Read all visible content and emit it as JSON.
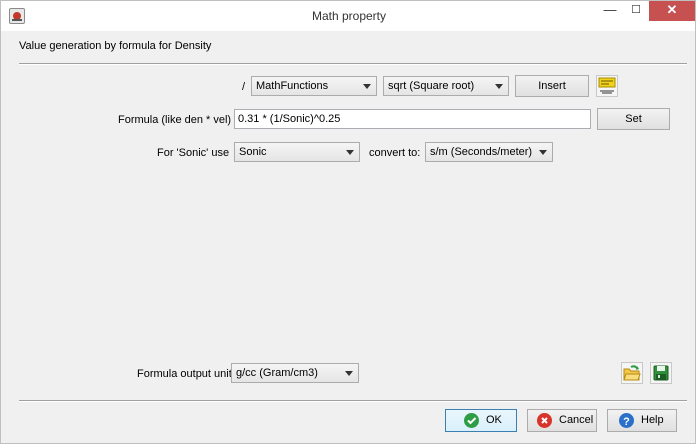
{
  "window": {
    "title": "Math property",
    "minimize_glyph": "—",
    "maximize_glyph": "☐",
    "close_glyph": "✕"
  },
  "heading": "Value generation by formula for Density",
  "functions_row": {
    "divider_label": "/",
    "category_value": "MathFunctions",
    "function_value": "sqrt (Square root)",
    "insert_label": "Insert",
    "formula_icon": "formula-editor-icon"
  },
  "formula": {
    "label": "Formula (like den * vel)",
    "value": "0.31 * (1/Sonic)^0.25",
    "set_label": "Set"
  },
  "variable_row": {
    "label": "For 'Sonic' use",
    "source_value": "Sonic",
    "convert_label": "convert to:",
    "unit_value": "s/m (Seconds/meter)"
  },
  "output": {
    "label": "Formula output unit",
    "unit_value": "g/cc (Gram/cm3)",
    "open_icon": "open-folder-icon",
    "save_icon": "save-disk-icon"
  },
  "buttons": {
    "ok": "OK",
    "cancel": "Cancel",
    "help": "Help"
  },
  "colors": {
    "close_button": "#c75050",
    "ok_check": "#2e9e46",
    "cancel_x": "#d9342b",
    "help_badge": "#2a6fc9"
  }
}
